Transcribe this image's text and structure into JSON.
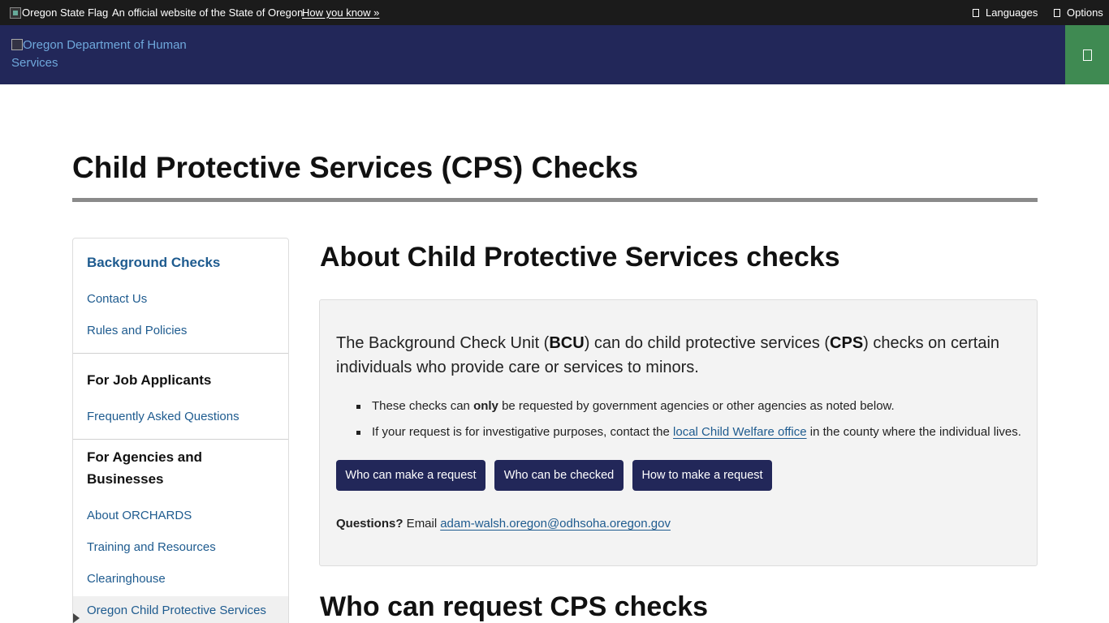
{
  "topbar": {
    "flag_alt": "Oregon State Flag",
    "official": "An official website of the State of Oregon",
    "how_you_know": "How you know »",
    "languages": "Languages",
    "options": "Options"
  },
  "header": {
    "logo_alt": "Oregon Department of Human Services"
  },
  "page": {
    "title": "Child Protective Services (CPS) Checks"
  },
  "sidebar": {
    "section1": {
      "heading": "Background Checks",
      "links": [
        "Contact Us",
        "Rules and Policies"
      ]
    },
    "section2": {
      "heading": "For Job Applicants",
      "links": [
        "Frequently Asked Questions"
      ]
    },
    "section3": {
      "heading": "For Agencies and Businesses",
      "links": [
        "About ORCHARDS",
        "Training and Resources",
        "Clearinghouse",
        "Oregon Child Protective Services"
      ]
    }
  },
  "main": {
    "about_heading": "About Child Protective Services checks",
    "intro": {
      "p1": "The Background Check Unit (",
      "b1": "BCU",
      "p2": ") can do child protective services (",
      "b2": "CPS",
      "p3": ") checks on certain individuals who provide care or services to minors."
    },
    "bullet1": {
      "pre": "These checks can ",
      "bold": "only",
      "post": " be requested by government agencies or other agencies as noted below."
    },
    "bullet2": {
      "pre": "If your request is for investigative purposes, contact the ",
      "link": "local Child Welfare office",
      "post": " in the county where the individual lives."
    },
    "buttons": [
      "Who can make a request",
      "Who can be checked",
      "How to make a request"
    ],
    "questions": {
      "label": "Questions?",
      "email_prefix": " Email",
      "email": "adam-walsh.oregon@odhsoha.oregon.gov"
    },
    "who_heading": "Who can request CPS checks"
  },
  "colors": {
    "topbar": "#1b1b1b",
    "header": "#222759",
    "menu_button": "#3f8a52",
    "link": "#1e5b8f",
    "button": "#222759"
  },
  "icons": {
    "languages": "globe-icon",
    "options": "options-icon",
    "menu": "menu-icon"
  }
}
